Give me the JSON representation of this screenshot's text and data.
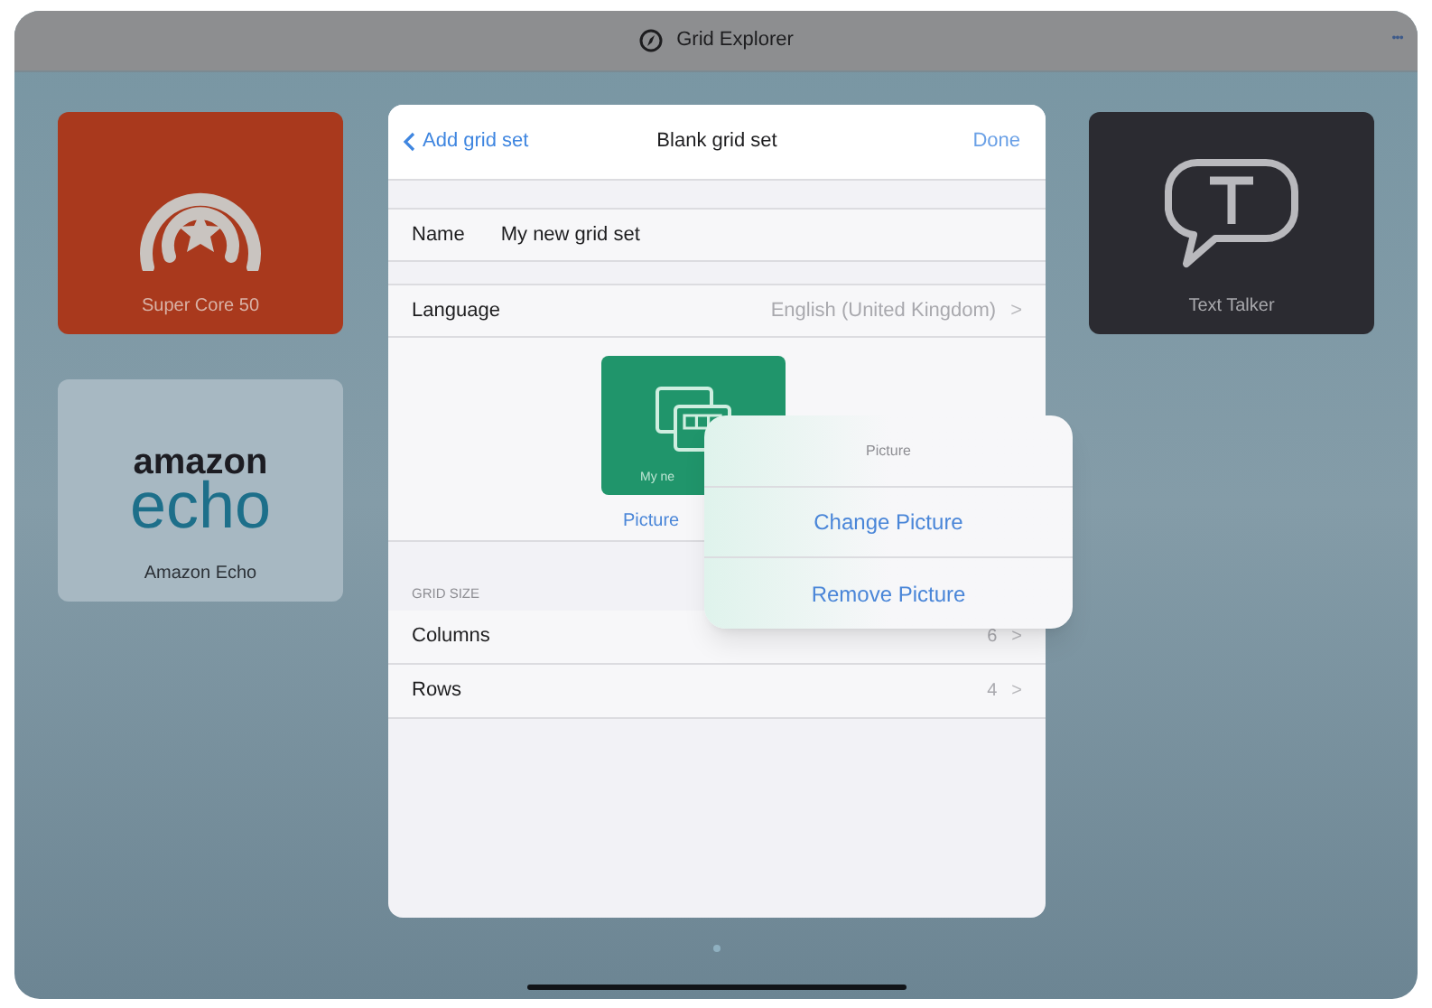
{
  "window": {
    "title": "Grid Explorer",
    "more": "•••"
  },
  "tiles_left": [
    {
      "kind": "icon",
      "label": "Super Core 50"
    },
    {
      "kind": "logo",
      "label": "Amazon Echo",
      "logo_lines": [
        "amazon",
        "echo"
      ]
    }
  ],
  "tiles_right": [
    {
      "kind": "bubble",
      "label": "Text Talker"
    }
  ],
  "dialog": {
    "back": "Add grid set",
    "title": "Blank grid set",
    "done": "Done",
    "name": {
      "label": "Name",
      "value": "My new grid set"
    },
    "language": {
      "label": "Language",
      "value": "English (United Kingdom)",
      "chevron": ">"
    },
    "picture": {
      "tile_label": "My ne",
      "link": "Picture"
    },
    "grid_size": {
      "header": "GRID SIZE",
      "rows": [
        {
          "label": "Columns",
          "value": "6",
          "chevron": ">"
        },
        {
          "label": "Rows",
          "value": "4",
          "chevron": ">"
        }
      ]
    }
  },
  "popover": {
    "title": "Picture",
    "actions": [
      "Change Picture",
      "Remove Picture"
    ]
  }
}
